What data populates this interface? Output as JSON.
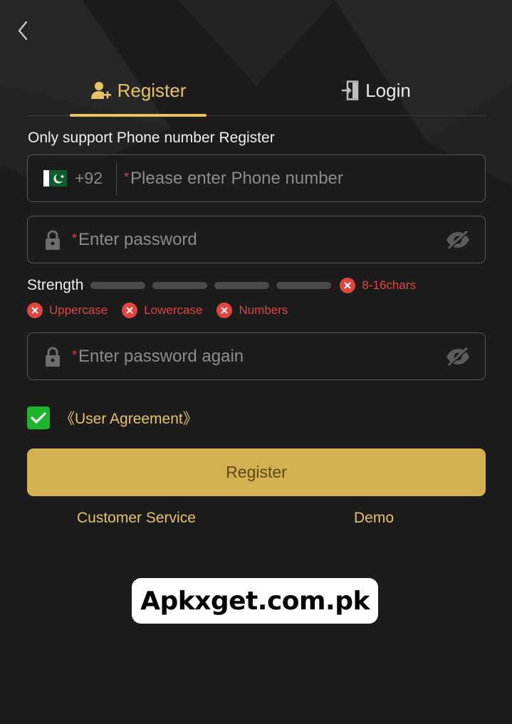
{
  "header": {
    "back_icon": "chevron-left-icon"
  },
  "tabs": [
    {
      "label": "Register",
      "icon": "user-add-icon",
      "active": true
    },
    {
      "label": "Login",
      "icon": "login-door-icon",
      "active": false
    }
  ],
  "notice": "Only support Phone number Register",
  "phone": {
    "flag": "pakistan-flag",
    "country_code": "+92",
    "required_mark": "*",
    "placeholder": "Please enter Phone number"
  },
  "password": {
    "required_mark": "*",
    "placeholder": "Enter password"
  },
  "strength": {
    "label": "Strength",
    "bars": 4,
    "rules": [
      "8-16chars",
      "Uppercase",
      "Lowercase",
      "Numbers"
    ]
  },
  "confirm_password": {
    "required_mark": "*",
    "placeholder": "Enter password again"
  },
  "agreement": {
    "checked": true,
    "label": "《User Agreement》"
  },
  "register_button": "Register",
  "links": {
    "customer_service": "Customer Service",
    "demo": "Demo"
  },
  "watermark": "Apkxget.com.pk",
  "colors": {
    "accent": "#e6c267",
    "button": "#d3b050",
    "error": "#e0453f",
    "check": "#1db52b"
  }
}
